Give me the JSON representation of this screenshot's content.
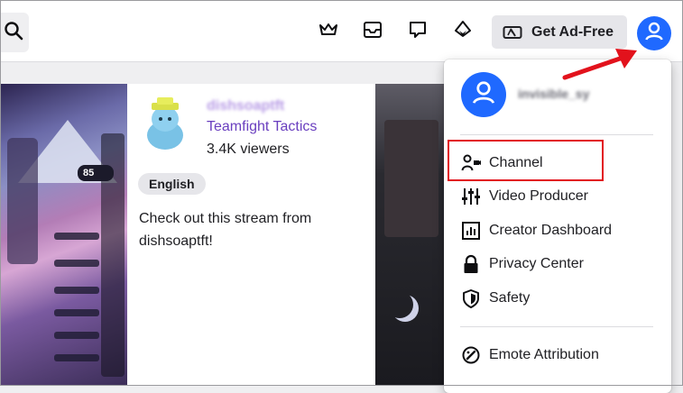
{
  "nav": {
    "search_icon": "search-icon",
    "crown_icon": "crown-icon",
    "inbox_icon": "inbox-icon",
    "whispers_icon": "chat-bubble-icon",
    "bits_icon": "bits-icon",
    "ad_free_label": "Get Ad-Free",
    "profile_icon": "user-icon"
  },
  "stream_card": {
    "streamer_name": "dishsoaptft",
    "game": "Teamfight Tactics",
    "viewers": "3.4K viewers",
    "tag": "English",
    "description": "Check out this stream from dishsoaptft!"
  },
  "game_hud": {
    "gold": "85"
  },
  "user_menu": {
    "username": "invisible_sy",
    "items": [
      {
        "label": "Channel",
        "icon": "channel-icon"
      },
      {
        "label": "Video Producer",
        "icon": "sliders-icon"
      },
      {
        "label": "Creator Dashboard",
        "icon": "dashboard-icon"
      },
      {
        "label": "Privacy Center",
        "icon": "lock-icon"
      },
      {
        "label": "Safety",
        "icon": "shield-icon"
      },
      {
        "label": "Emote Attribution",
        "icon": "emote-icon"
      }
    ]
  },
  "colors": {
    "accent_blue": "#1f69ff",
    "game_purple": "#6a3fbf",
    "annotation_red": "#e2121c"
  }
}
